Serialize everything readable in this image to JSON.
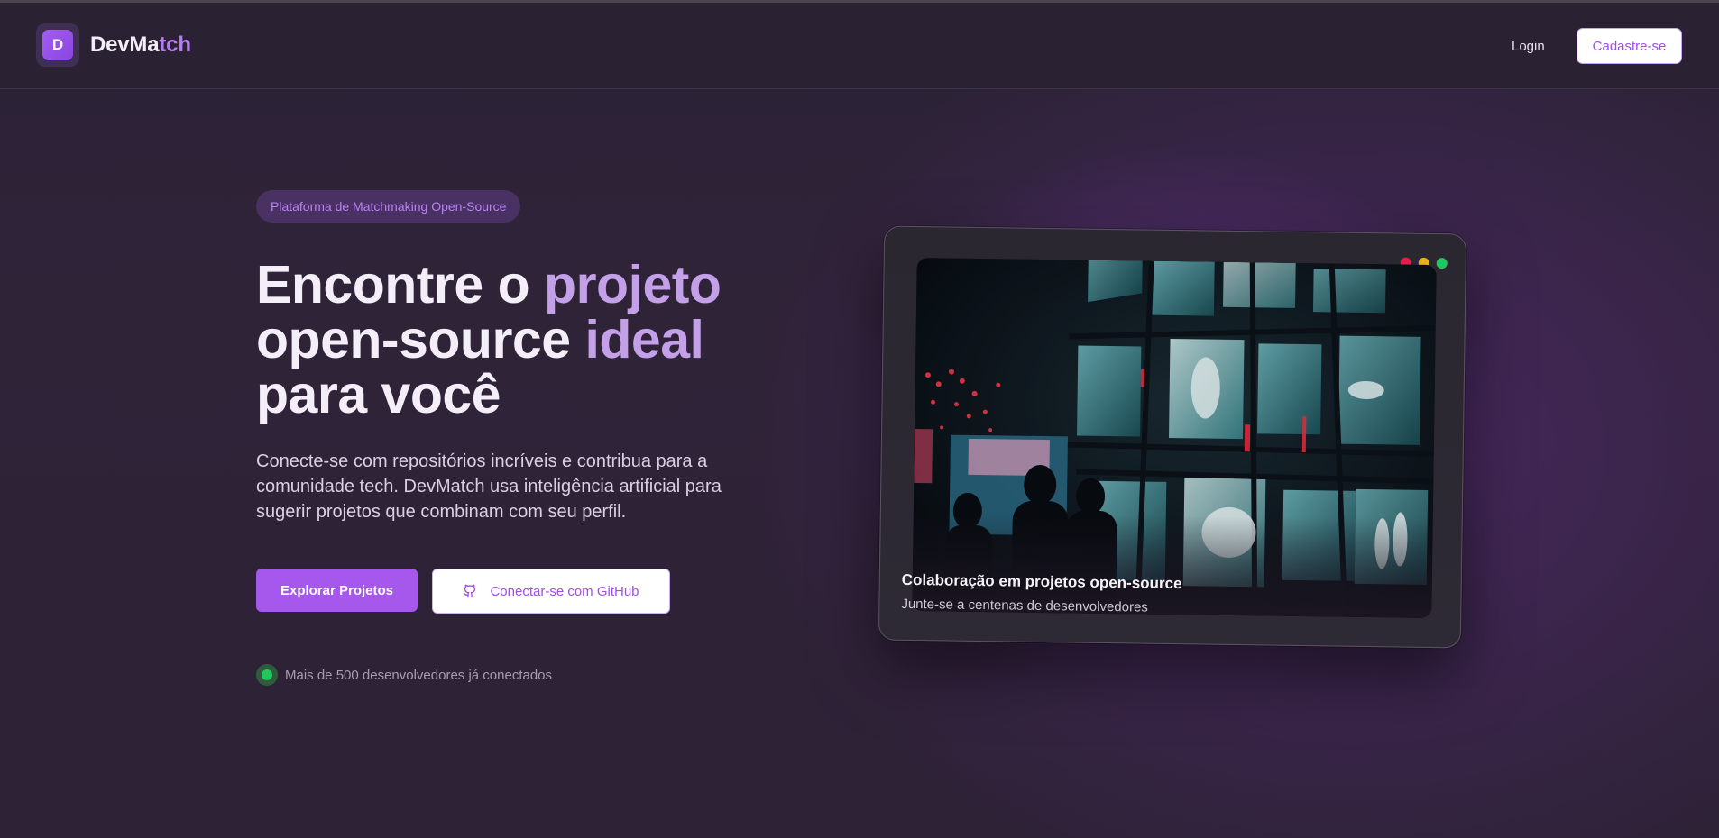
{
  "header": {
    "logo_letter": "D",
    "brand_part1": "DevMa",
    "brand_part2": "tch",
    "login_label": "Login",
    "signup_label": "Cadastre-se"
  },
  "hero": {
    "badge": "Plataforma de Matchmaking Open-Source",
    "headline": {
      "line1_a": "Encontre o ",
      "line1_b": "projeto",
      "line2_a": "open-source ",
      "line2_b": "ideal",
      "line3": "para você"
    },
    "description": "Conecte-se com repositórios incríveis e contribua para a comunidade tech. DevMatch usa inteligência artificial para sugerir projetos que combinam com seu perfil.",
    "primary_button": "Explorar Projetos",
    "secondary_button": "Conectar-se com GitHub",
    "status_text": "Mais de 500 desenvolvedores já conectados"
  },
  "card": {
    "title": "Colaboração em projetos open-source",
    "subtitle": "Junte-se a centenas de desenvolvedores",
    "window_controls": [
      "red",
      "yellow",
      "green"
    ]
  },
  "colors": {
    "accent": "#a657ec",
    "accent_text": "#b57ef0",
    "background": "#2d2236",
    "status_green": "#22c55e"
  },
  "icons": {
    "logo": "letter-d-logo",
    "github": "github-icon",
    "status": "online-dot-icon"
  }
}
